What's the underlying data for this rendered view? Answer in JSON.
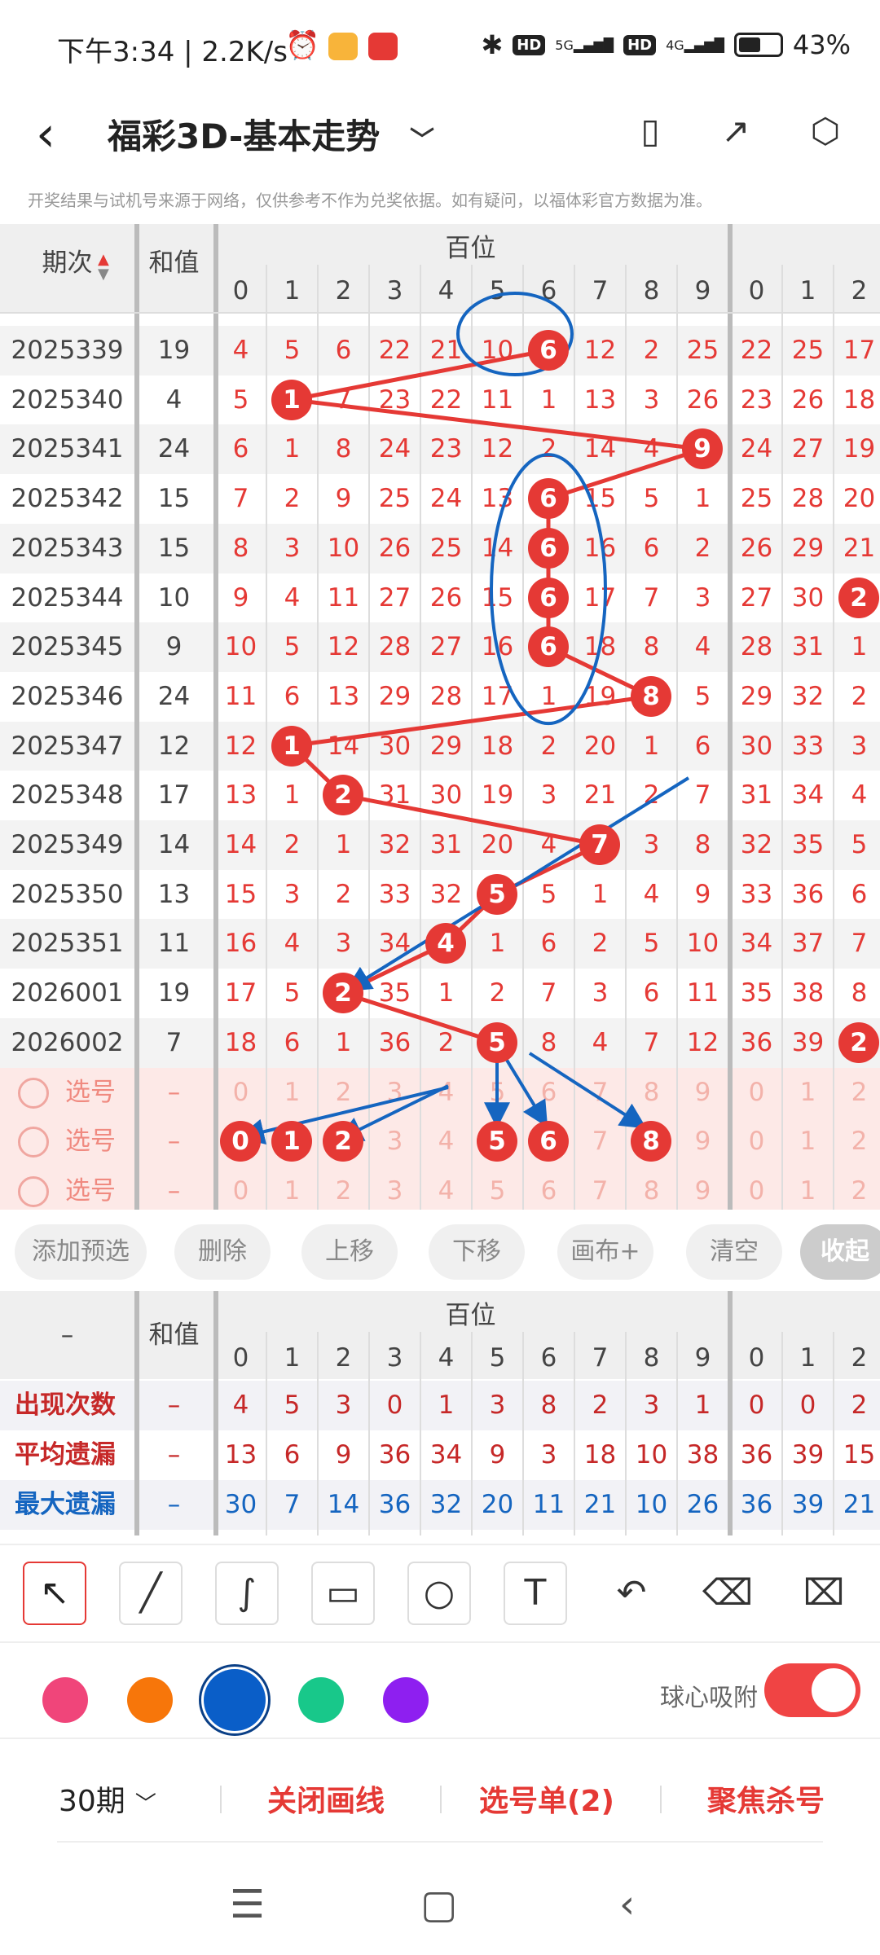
{
  "status": {
    "time": "下午3:34 | 2.2K/s",
    "battery": "43%",
    "net1": "5G",
    "net2": "4G",
    "hd": "HD"
  },
  "header": {
    "title": "福彩3D-基本走势"
  },
  "notice": "开奖结果与试机号来源于网络，仅供参考不作为兑奖依据。如有疑问，以福体彩官方数据为准。",
  "table": {
    "col_period": "期次",
    "col_sum": "和值",
    "group_label": "百位",
    "digits": [
      "0",
      "1",
      "2",
      "3",
      "4",
      "5",
      "6",
      "7",
      "8",
      "9"
    ],
    "extra_digits": [
      "0",
      "1",
      "2"
    ],
    "rows": [
      {
        "period": "2025339",
        "sum": "19",
        "cells": [
          "4",
          "5",
          "6",
          "22",
          "21",
          "10",
          "6",
          "12",
          "2",
          "25"
        ],
        "extra": [
          "22",
          "25",
          "17"
        ]
      },
      {
        "period": "2025340",
        "sum": "4",
        "cells": [
          "5",
          "1",
          "7",
          "23",
          "22",
          "11",
          "1",
          "13",
          "3",
          "26"
        ],
        "extra": [
          "23",
          "26",
          "18"
        ]
      },
      {
        "period": "2025341",
        "sum": "24",
        "cells": [
          "6",
          "1",
          "8",
          "24",
          "23",
          "12",
          "2",
          "14",
          "4",
          "9"
        ],
        "extra": [
          "24",
          "27",
          "19"
        ]
      },
      {
        "period": "2025342",
        "sum": "15",
        "cells": [
          "7",
          "2",
          "9",
          "25",
          "24",
          "13",
          "6",
          "15",
          "5",
          "1"
        ],
        "extra": [
          "25",
          "28",
          "20"
        ]
      },
      {
        "period": "2025343",
        "sum": "15",
        "cells": [
          "8",
          "3",
          "10",
          "26",
          "25",
          "14",
          "6",
          "16",
          "6",
          "2"
        ],
        "extra": [
          "26",
          "29",
          "21"
        ]
      },
      {
        "period": "2025344",
        "sum": "10",
        "cells": [
          "9",
          "4",
          "11",
          "27",
          "26",
          "15",
          "6",
          "17",
          "7",
          "3"
        ],
        "extra": [
          "27",
          "30",
          "2"
        ]
      },
      {
        "period": "2025345",
        "sum": "9",
        "cells": [
          "10",
          "5",
          "12",
          "28",
          "27",
          "16",
          "6",
          "18",
          "8",
          "4"
        ],
        "extra": [
          "28",
          "31",
          "1"
        ]
      },
      {
        "period": "2025346",
        "sum": "24",
        "cells": [
          "11",
          "6",
          "13",
          "29",
          "28",
          "17",
          "1",
          "19",
          "8",
          "5"
        ],
        "extra": [
          "29",
          "32",
          "2"
        ]
      },
      {
        "period": "2025347",
        "sum": "12",
        "cells": [
          "12",
          "1",
          "14",
          "30",
          "29",
          "18",
          "2",
          "20",
          "1",
          "6"
        ],
        "extra": [
          "30",
          "33",
          "3"
        ]
      },
      {
        "period": "2025348",
        "sum": "17",
        "cells": [
          "13",
          "1",
          "2",
          "31",
          "30",
          "19",
          "3",
          "21",
          "2",
          "7"
        ],
        "extra": [
          "31",
          "34",
          "4"
        ]
      },
      {
        "period": "2025349",
        "sum": "14",
        "cells": [
          "14",
          "2",
          "1",
          "32",
          "31",
          "20",
          "4",
          "7",
          "3",
          "8"
        ],
        "extra": [
          "32",
          "35",
          "5"
        ]
      },
      {
        "period": "2025350",
        "sum": "13",
        "cells": [
          "15",
          "3",
          "2",
          "33",
          "32",
          "5",
          "5",
          "1",
          "4",
          "9"
        ],
        "extra": [
          "33",
          "36",
          "6"
        ]
      },
      {
        "period": "2025351",
        "sum": "11",
        "cells": [
          "16",
          "4",
          "3",
          "34",
          "4",
          "1",
          "6",
          "2",
          "5",
          "10"
        ],
        "extra": [
          "34",
          "37",
          "7"
        ]
      },
      {
        "period": "2026001",
        "sum": "19",
        "cells": [
          "17",
          "5",
          "2",
          "35",
          "1",
          "2",
          "7",
          "3",
          "6",
          "11"
        ],
        "extra": [
          "35",
          "38",
          "8"
        ]
      },
      {
        "period": "2026002",
        "sum": "7",
        "cells": [
          "18",
          "6",
          "1",
          "36",
          "2",
          "5",
          "8",
          "4",
          "7",
          "12"
        ],
        "extra": [
          "36",
          "39",
          "2"
        ]
      }
    ],
    "balls": [
      6,
      1,
      9,
      6,
      6,
      6,
      6,
      8,
      1,
      2,
      7,
      5,
      4,
      2,
      5
    ],
    "extra_balls": [
      {
        "row": 5,
        "col": 2,
        "value": "2"
      },
      {
        "row": 14,
        "col": 2,
        "value": "2"
      }
    ],
    "pick_label": "选号",
    "pick_sum": "–",
    "pick_rows": [
      {
        "selected": []
      },
      {
        "selected": [
          0,
          1,
          2,
          5,
          6,
          8
        ]
      },
      {
        "selected": []
      }
    ]
  },
  "buttons": [
    "添加预选",
    "删除",
    "上移",
    "下移",
    "画布+",
    "清空",
    "收起"
  ],
  "stats": {
    "corner": "–",
    "col_sum": "和值",
    "group_label": "百位",
    "rows": [
      {
        "label": "出现次数",
        "sum": "–",
        "color": "#c62828",
        "values": [
          "4",
          "5",
          "3",
          "0",
          "1",
          "3",
          "8",
          "2",
          "3",
          "1"
        ],
        "extra": [
          "0",
          "0",
          "2"
        ]
      },
      {
        "label": "平均遗漏",
        "sum": "–",
        "color": "#c62828",
        "values": [
          "13",
          "6",
          "9",
          "36",
          "34",
          "9",
          "3",
          "18",
          "10",
          "38"
        ],
        "extra": [
          "36",
          "39",
          "15"
        ]
      },
      {
        "label": "最大遗漏",
        "sum": "–",
        "color": "#1565c0",
        "values": [
          "30",
          "7",
          "14",
          "36",
          "32",
          "20",
          "11",
          "21",
          "10",
          "26"
        ],
        "extra": [
          "36",
          "39",
          "21"
        ]
      }
    ]
  },
  "tools": [
    "arrow-tool",
    "line-tool",
    "curve-tool",
    "rect-tool",
    "circle-tool",
    "text-tool",
    "undo-tool",
    "eraser-tool",
    "clear-brush-tool"
  ],
  "colors": [
    "#f0457a",
    "#f7760a",
    "#0a5ec8",
    "#18c88a",
    "#8e1ff0"
  ],
  "snap_label": "球心吸附",
  "bottom": {
    "period": "30期",
    "close_draw": "关闭画线",
    "pick_list": "选号单(2)",
    "focus_kill": "聚焦杀号"
  }
}
